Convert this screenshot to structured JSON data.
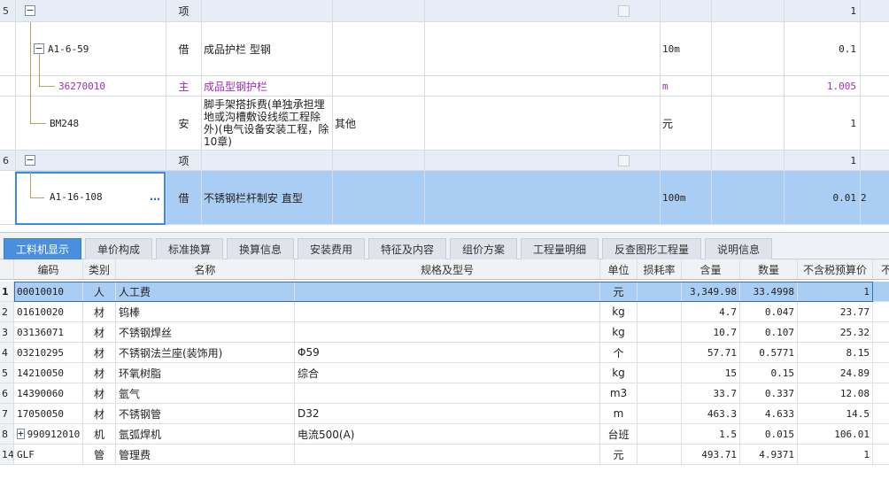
{
  "upper_rows": [
    {
      "num": "5",
      "expander": "−",
      "type": "项",
      "qty": "1"
    },
    {
      "code": "A1-6-59",
      "expander": "−",
      "type": "借",
      "name": "成品护栏 型钢",
      "unit": "10m",
      "qty": "0.1"
    },
    {
      "code": "36270010",
      "type": "主",
      "name": "成品型钢护栏",
      "unit": "m",
      "qty": "1.005"
    },
    {
      "code": "BM248",
      "type": "安",
      "name": "脚手架搭拆费(单独承担埋地或沟槽敷设线缆工程除外)(电气设备安装工程，除10章)",
      "spec": "其他",
      "unit": "元",
      "qty": "1"
    },
    {
      "num": "6",
      "expander": "−",
      "type": "项",
      "qty": "1"
    },
    {
      "code": "A1-16-108",
      "ellipsis": "…",
      "type": "借",
      "name": "不锈钢栏杆制安 直型",
      "unit": "100m",
      "qty": "0.01",
      "extra": "2"
    }
  ],
  "tabs": [
    "工料机显示",
    "单价构成",
    "标准换算",
    "换算信息",
    "安装费用",
    "特征及内容",
    "组价方案",
    "工程量明细",
    "反查图形工程量",
    "说明信息"
  ],
  "table": {
    "columns": [
      "编码",
      "类别",
      "名称",
      "规格及型号",
      "单位",
      "损耗率",
      "含量",
      "数量",
      "不含税预算价",
      "不"
    ],
    "rows": [
      {
        "num": "1",
        "code": "00010010",
        "cat": "人",
        "name": "人工费",
        "spec": "",
        "unit": "元",
        "loss": "",
        "content": "3,349.98",
        "qty": "33.4998",
        "price": "1"
      },
      {
        "num": "2",
        "code": "01610020",
        "cat": "材",
        "name": "钨棒",
        "spec": "",
        "unit": "kg",
        "loss": "",
        "content": "4.7",
        "qty": "0.047",
        "price": "23.77"
      },
      {
        "num": "3",
        "code": "03136071",
        "cat": "材",
        "name": "不锈钢焊丝",
        "spec": "",
        "unit": "kg",
        "loss": "",
        "content": "10.7",
        "qty": "0.107",
        "price": "25.32"
      },
      {
        "num": "4",
        "code": "03210295",
        "cat": "材",
        "name": "不锈钢法兰座(装饰用)",
        "spec": "Φ59",
        "unit": "个",
        "loss": "",
        "content": "57.71",
        "qty": "0.5771",
        "price": "8.15"
      },
      {
        "num": "5",
        "code": "14210050",
        "cat": "材",
        "name": "环氧树脂",
        "spec": "综合",
        "unit": "kg",
        "loss": "",
        "content": "15",
        "qty": "0.15",
        "price": "24.89"
      },
      {
        "num": "6",
        "code": "14390060",
        "cat": "材",
        "name": "氩气",
        "spec": "",
        "unit": "m3",
        "loss": "",
        "content": "33.7",
        "qty": "0.337",
        "price": "12.08"
      },
      {
        "num": "7",
        "code": "17050050",
        "cat": "材",
        "name": "不锈钢管",
        "spec": "D32",
        "unit": "m",
        "loss": "",
        "content": "463.3",
        "qty": "4.633",
        "price": "14.5"
      },
      {
        "num": "8",
        "expander": "+",
        "code": "990912010",
        "cat": "机",
        "name": "氩弧焊机",
        "spec": "电流500(A)",
        "unit": "台班",
        "loss": "",
        "content": "1.5",
        "qty": "0.015",
        "price": "106.01"
      },
      {
        "num": "14",
        "code": "GLF",
        "cat": "管",
        "name": "管理费",
        "spec": "",
        "unit": "元",
        "loss": "",
        "content": "493.71",
        "qty": "4.9371",
        "price": "1"
      }
    ]
  }
}
